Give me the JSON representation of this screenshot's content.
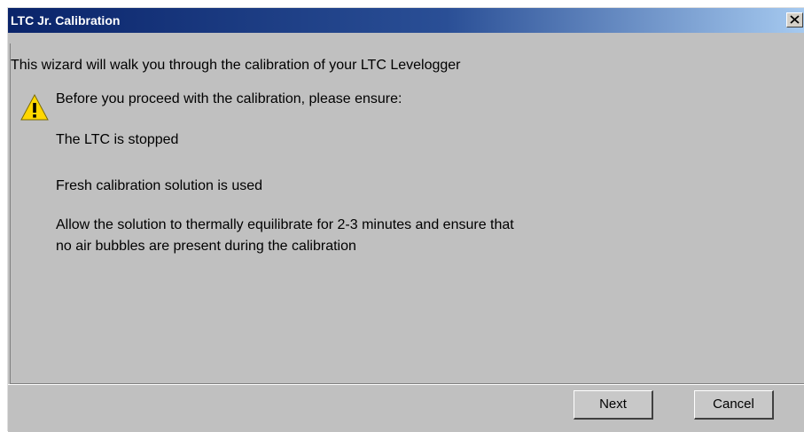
{
  "window": {
    "title": "LTC Jr. Calibration",
    "close_label": "X"
  },
  "content": {
    "intro": "This wizard will walk you through the calibration of your LTC Levelogger",
    "warning_icon": "warning-icon",
    "warning_heading": "Before you proceed with the calibration, please ensure:",
    "items": [
      "The LTC is stopped",
      "Fresh calibration solution is used",
      "Allow the solution to thermally equilibrate for 2-3 minutes and ensure that",
      "no air bubbles are present during the calibration"
    ]
  },
  "buttons": {
    "next_label": "Next",
    "cancel_label": "Cancel"
  },
  "colors": {
    "titlebar_start": "#0a246a",
    "titlebar_end": "#a6caf0",
    "dialog_background": "#c0c0c0",
    "warning_yellow": "#ffd700"
  }
}
